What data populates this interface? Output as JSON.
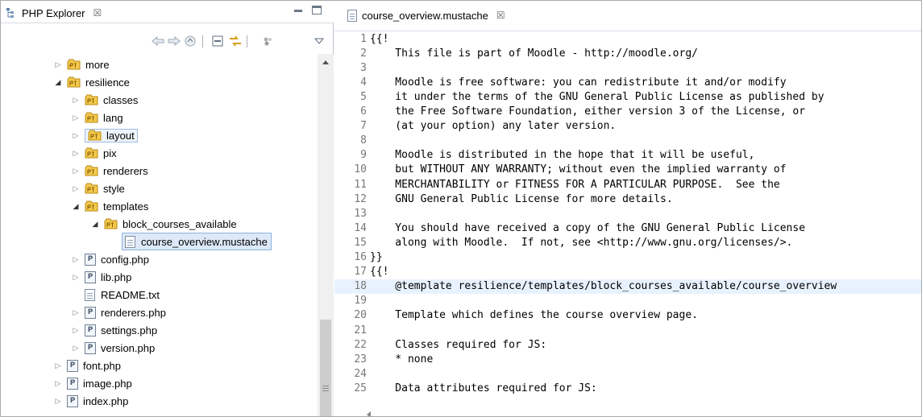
{
  "left_view": {
    "tab_title": "PHP Explorer",
    "tab_close": "☒",
    "tree": [
      {
        "label": "more",
        "type": "package",
        "expanded": false,
        "depth": 0
      },
      {
        "label": "resilience",
        "type": "package",
        "expanded": true,
        "depth": 0
      },
      {
        "label": "classes",
        "type": "package",
        "expanded": false,
        "depth": 1
      },
      {
        "label": "lang",
        "type": "package",
        "expanded": false,
        "depth": 1
      },
      {
        "label": "layout",
        "type": "package",
        "expanded": false,
        "depth": 1,
        "highlighted": true
      },
      {
        "label": "pix",
        "type": "package",
        "expanded": false,
        "depth": 1
      },
      {
        "label": "renderers",
        "type": "package",
        "expanded": false,
        "depth": 1
      },
      {
        "label": "style",
        "type": "package",
        "expanded": false,
        "depth": 1
      },
      {
        "label": "templates",
        "type": "package",
        "expanded": true,
        "depth": 1
      },
      {
        "label": "block_courses_available",
        "type": "package",
        "expanded": true,
        "depth": 2
      },
      {
        "label": "course_overview.mustache",
        "type": "text",
        "depth": 3,
        "selected": true
      },
      {
        "label": "config.php",
        "type": "php",
        "expanded": false,
        "depth": 1
      },
      {
        "label": "lib.php",
        "type": "php",
        "expanded": false,
        "depth": 1
      },
      {
        "label": "README.txt",
        "type": "text",
        "depth": 1
      },
      {
        "label": "renderers.php",
        "type": "php",
        "expanded": false,
        "depth": 1
      },
      {
        "label": "settings.php",
        "type": "php",
        "expanded": false,
        "depth": 1
      },
      {
        "label": "version.php",
        "type": "php",
        "expanded": false,
        "depth": 1
      },
      {
        "label": "font.php",
        "type": "php",
        "expanded": false,
        "depth": 0
      },
      {
        "label": "image.php",
        "type": "php",
        "expanded": false,
        "depth": 0
      },
      {
        "label": "index.php",
        "type": "php",
        "expanded": false,
        "depth": 0
      }
    ]
  },
  "editor": {
    "tab_title": "course_overview.mustache",
    "tab_close": "☒",
    "current_line": 18,
    "lines": [
      {
        "n": "1",
        "text": "{{!"
      },
      {
        "n": "2",
        "text": "    This file is part of Moodle - http://moodle.org/"
      },
      {
        "n": "3",
        "text": ""
      },
      {
        "n": "4",
        "text": "    Moodle is free software: you can redistribute it and/or modify"
      },
      {
        "n": "5",
        "text": "    it under the terms of the GNU General Public License as published by"
      },
      {
        "n": "6",
        "text": "    the Free Software Foundation, either version 3 of the License, or"
      },
      {
        "n": "7",
        "text": "    (at your option) any later version."
      },
      {
        "n": "8",
        "text": ""
      },
      {
        "n": "9",
        "text": "    Moodle is distributed in the hope that it will be useful,"
      },
      {
        "n": "10",
        "text": "    but WITHOUT ANY WARRANTY; without even the implied warranty of"
      },
      {
        "n": "11",
        "text": "    MERCHANTABILITY or FITNESS FOR A PARTICULAR PURPOSE.  See the"
      },
      {
        "n": "12",
        "text": "    GNU General Public License for more details."
      },
      {
        "n": "13",
        "text": ""
      },
      {
        "n": "14",
        "text": "    You should have received a copy of the GNU General Public License"
      },
      {
        "n": "15",
        "text": "    along with Moodle.  If not, see <http://www.gnu.org/licenses/>."
      },
      {
        "n": "16",
        "text": "}}"
      },
      {
        "n": "17",
        "text": "{{!"
      },
      {
        "n": "18",
        "text": "    @template resilience/templates/block_courses_available/course_overview"
      },
      {
        "n": "19",
        "text": ""
      },
      {
        "n": "20",
        "text": "    Template which defines the course overview page."
      },
      {
        "n": "21",
        "text": ""
      },
      {
        "n": "22",
        "text": "    Classes required for JS:"
      },
      {
        "n": "23",
        "text": "    * none"
      },
      {
        "n": "24",
        "text": ""
      },
      {
        "n": "25",
        "text": "    Data attributes required for JS:"
      }
    ]
  },
  "colors": {
    "current_line": "#e8f2fe",
    "selection": "#dde9f8",
    "package_yellow": "#f2c94c",
    "line_number": "#787878"
  }
}
